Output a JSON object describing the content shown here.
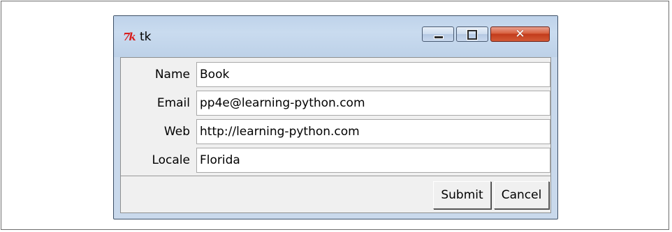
{
  "window": {
    "title": "tk",
    "icon_text": "7k",
    "controls": {
      "minimize": "minimize",
      "maximize": "maximize",
      "close": "✕"
    }
  },
  "form": {
    "fields": [
      {
        "label": "Name",
        "value": "Book"
      },
      {
        "label": "Email",
        "value": "pp4e@learning-python.com"
      },
      {
        "label": "Web",
        "value": "http://learning-python.com"
      },
      {
        "label": "Locale",
        "value": "Florida"
      }
    ]
  },
  "buttons": {
    "submit": "Submit",
    "cancel": "Cancel"
  },
  "colors": {
    "titlebar": "#c9dbef",
    "close": "#c84524",
    "client": "#f0f0f0"
  }
}
